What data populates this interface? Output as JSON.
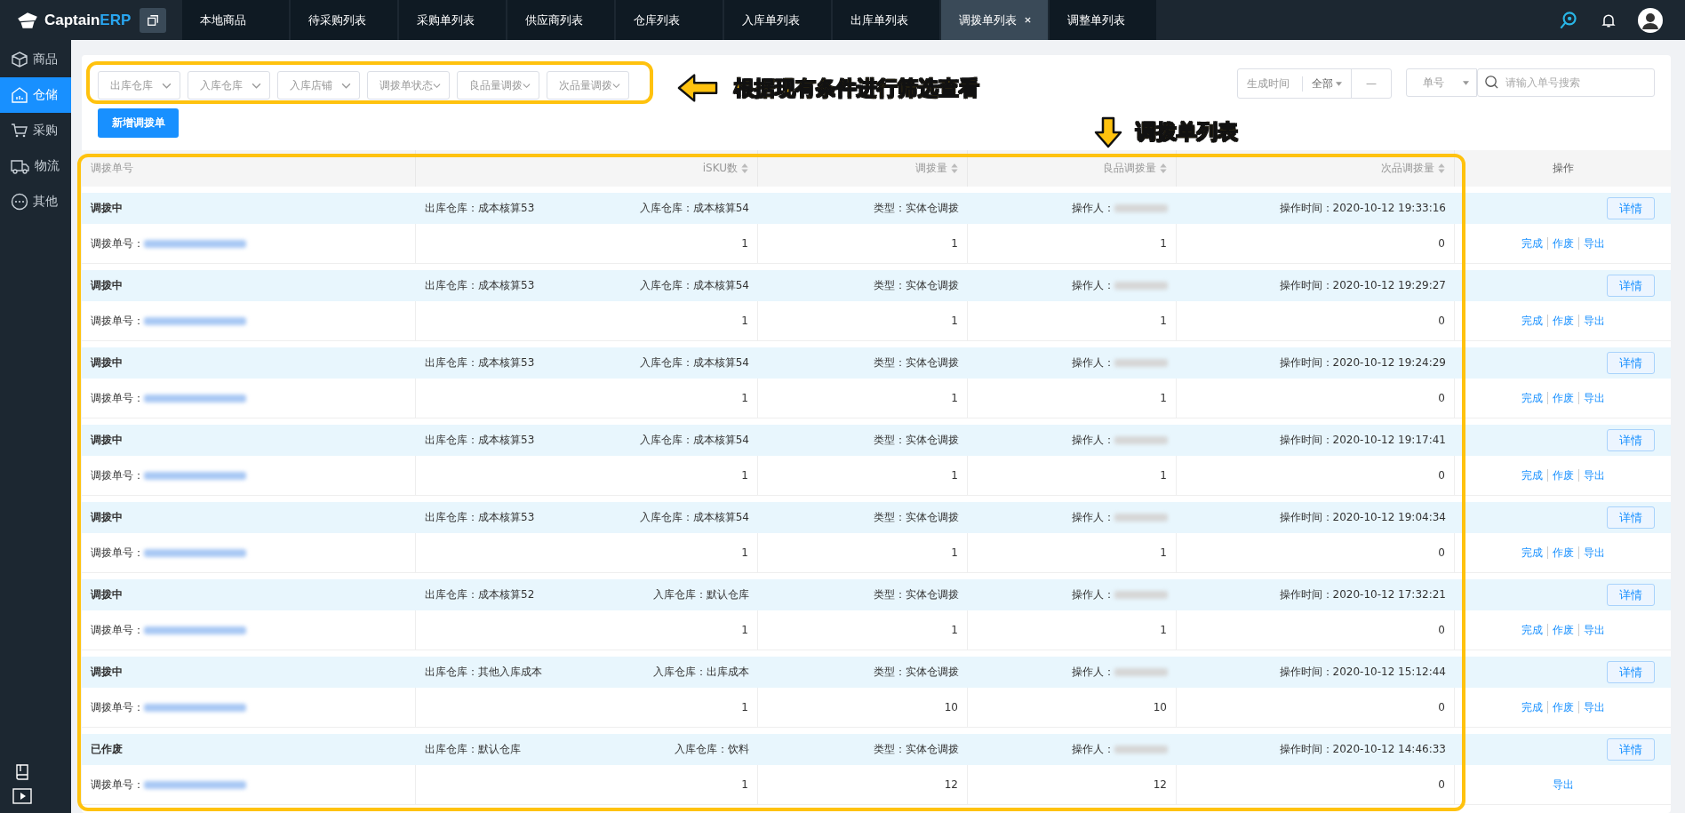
{
  "brand": {
    "name_part": "Captain",
    "name_accent": "ERP"
  },
  "tabs": [
    {
      "label": "本地商品",
      "selected": false,
      "closable": false
    },
    {
      "label": "待采购列表",
      "selected": false,
      "closable": false
    },
    {
      "label": "采购单列表",
      "selected": false,
      "closable": false
    },
    {
      "label": "供应商列表",
      "selected": false,
      "closable": false
    },
    {
      "label": "仓库列表",
      "selected": false,
      "closable": false
    },
    {
      "label": "入库单列表",
      "selected": false,
      "closable": false
    },
    {
      "label": "出库单列表",
      "selected": false,
      "closable": false
    },
    {
      "label": "调拨单列表",
      "selected": true,
      "closable": true
    },
    {
      "label": "调整单列表",
      "selected": false,
      "closable": false
    }
  ],
  "sidebar": {
    "items": [
      {
        "label": "商品",
        "kind": "box",
        "selected": false
      },
      {
        "label": "仓储",
        "kind": "warehouse",
        "selected": true
      },
      {
        "label": "采购",
        "kind": "cart",
        "selected": false
      },
      {
        "label": "物流",
        "kind": "truck",
        "selected": false
      },
      {
        "label": "其他",
        "kind": "more",
        "selected": false
      }
    ]
  },
  "filters": [
    {
      "placeholder": "出库仓库"
    },
    {
      "placeholder": "入库仓库"
    },
    {
      "placeholder": "入库店铺"
    },
    {
      "placeholder": "调拨单状态"
    },
    {
      "placeholder": "良品量调拨"
    },
    {
      "placeholder": "次品量调拨"
    }
  ],
  "date_filter": {
    "label": "生成时间",
    "range": "全部",
    "separator": "—"
  },
  "search": {
    "field": "单号",
    "placeholder": "请输入单号搜索"
  },
  "new_button": "新增调拨单",
  "annotations": [
    {
      "text": "根据现有条件进行筛选查看"
    },
    {
      "text": "调拨单列表"
    }
  ],
  "table": {
    "columns": [
      {
        "label": "调拨单号",
        "sortable": false
      },
      {
        "label": "iSKU数",
        "sortable": true
      },
      {
        "label": "调拨量",
        "sortable": true
      },
      {
        "label": "良品调拨量",
        "sortable": true
      },
      {
        "label": "次品调拨量",
        "sortable": true
      },
      {
        "label": "操作",
        "sortable": false
      }
    ],
    "rows": [
      {
        "status": "调拨中",
        "from": "出库仓库：成本核算53",
        "to": "入库仓库：成本核算54",
        "type": "类型：实体仓调拨",
        "operator_label": "操作人：",
        "detail": "详情",
        "order_label": "调拨单号：",
        "time": "操作时间：2020-10-12 19:33:16",
        "isku": "1",
        "qty": "1",
        "good": "1",
        "bad": "0",
        "actions": [
          "完成",
          "作废",
          "导出"
        ]
      },
      {
        "status": "调拨中",
        "from": "出库仓库：成本核算53",
        "to": "入库仓库：成本核算54",
        "type": "类型：实体仓调拨",
        "operator_label": "操作人：",
        "detail": "详情",
        "order_label": "调拨单号：",
        "time": "操作时间：2020-10-12 19:29:27",
        "isku": "1",
        "qty": "1",
        "good": "1",
        "bad": "0",
        "actions": [
          "完成",
          "作废",
          "导出"
        ]
      },
      {
        "status": "调拨中",
        "from": "出库仓库：成本核算53",
        "to": "入库仓库：成本核算54",
        "type": "类型：实体仓调拨",
        "operator_label": "操作人：",
        "detail": "详情",
        "order_label": "调拨单号：",
        "time": "操作时间：2020-10-12 19:24:29",
        "isku": "1",
        "qty": "1",
        "good": "1",
        "bad": "0",
        "actions": [
          "完成",
          "作废",
          "导出"
        ]
      },
      {
        "status": "调拨中",
        "from": "出库仓库：成本核算53",
        "to": "入库仓库：成本核算54",
        "type": "类型：实体仓调拨",
        "operator_label": "操作人：",
        "detail": "详情",
        "order_label": "调拨单号：",
        "time": "操作时间：2020-10-12 19:17:41",
        "isku": "1",
        "qty": "1",
        "good": "1",
        "bad": "0",
        "actions": [
          "完成",
          "作废",
          "导出"
        ]
      },
      {
        "status": "调拨中",
        "from": "出库仓库：成本核算53",
        "to": "入库仓库：成本核算54",
        "type": "类型：实体仓调拨",
        "operator_label": "操作人：",
        "detail": "详情",
        "order_label": "调拨单号：",
        "time": "操作时间：2020-10-12 19:04:34",
        "isku": "1",
        "qty": "1",
        "good": "1",
        "bad": "0",
        "actions": [
          "完成",
          "作废",
          "导出"
        ]
      },
      {
        "status": "调拨中",
        "from": "出库仓库：成本核算52",
        "to": "入库仓库：默认仓库",
        "type": "类型：实体仓调拨",
        "operator_label": "操作人：",
        "detail": "详情",
        "order_label": "调拨单号：",
        "time": "操作时间：2020-10-12 17:32:21",
        "isku": "1",
        "qty": "1",
        "good": "1",
        "bad": "0",
        "actions": [
          "完成",
          "作废",
          "导出"
        ]
      },
      {
        "status": "调拨中",
        "from": "出库仓库：其他入库成本",
        "to": "入库仓库：出库成本",
        "type": "类型：实体仓调拨",
        "operator_label": "操作人：",
        "detail": "详情",
        "order_label": "调拨单号：",
        "time": "操作时间：2020-10-12 15:12:44",
        "isku": "1",
        "qty": "10",
        "good": "10",
        "bad": "0",
        "actions": [
          "完成",
          "作废",
          "导出"
        ]
      },
      {
        "status": "已作废",
        "from": "出库仓库：默认仓库",
        "to": "入库仓库：饮料",
        "type": "类型：实体仓调拨",
        "operator_label": "操作人：",
        "detail": "详情",
        "order_label": "调拨单号：",
        "time": "操作时间：2020-10-12 14:46:33",
        "isku": "1",
        "qty": "12",
        "good": "12",
        "bad": "0",
        "actions": [
          "导出"
        ]
      }
    ]
  }
}
